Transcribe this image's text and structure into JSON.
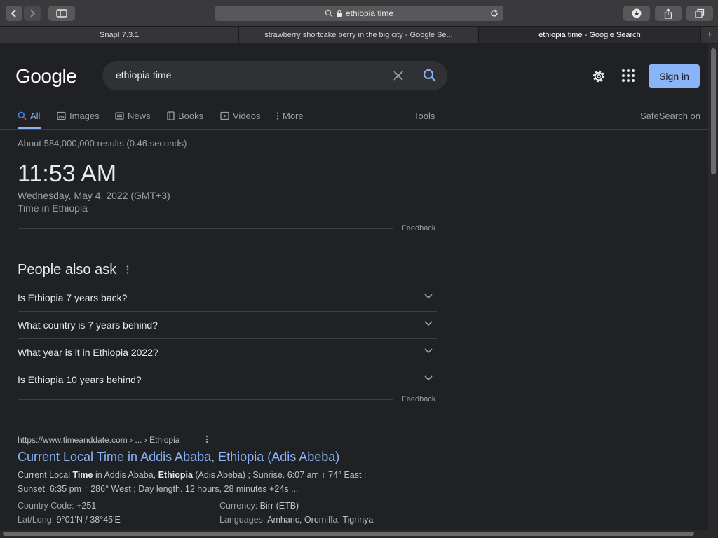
{
  "browser": {
    "address": "ethiopia time",
    "tabs": [
      {
        "label": "Snap! 7.3.1",
        "active": false
      },
      {
        "label": "strawberry shortcake berry in the big city - Google Se...",
        "active": false
      },
      {
        "label": "ethiopia time - Google Search",
        "active": true
      }
    ],
    "new_tab_symbol": "+"
  },
  "header": {
    "logo": "Google",
    "query": "ethiopia time",
    "signin_label": "Sign in"
  },
  "nav": {
    "items": [
      {
        "label": "All",
        "icon": "search-icon"
      },
      {
        "label": "Images",
        "icon": "image-icon"
      },
      {
        "label": "News",
        "icon": "news-icon"
      },
      {
        "label": "Books",
        "icon": "book-icon"
      },
      {
        "label": "Videos",
        "icon": "video-icon"
      },
      {
        "label": "More",
        "icon": "more-vertical-icon"
      }
    ],
    "tools": "Tools",
    "safesearch": "SafeSearch on"
  },
  "results": {
    "stats": "About 584,000,000 results (0.46 seconds)",
    "time_card": {
      "time": "11:53 AM",
      "date": "Wednesday, May 4, 2022 (GMT+3)",
      "place": "Time in Ethiopia",
      "feedback": "Feedback"
    },
    "people_also_ask": {
      "title": "People also ask",
      "questions": [
        "Is Ethiopia 7 years back?",
        "What country is 7 years behind?",
        "What year is it in Ethiopia 2022?",
        "Is Ethiopia 10 years behind?"
      ],
      "feedback": "Feedback"
    },
    "first_result": {
      "cite": "https://www.timeanddate.com › ... › Ethiopia",
      "title": "Current Local Time in Addis Ababa, Ethiopia (Adis Abeba)",
      "snippet_parts": {
        "p1": "Current Local ",
        "b1": "Time",
        "p2": " in Addis Ababa, ",
        "b2": "Ethiopia",
        "p3": " (Adis Abeba) ; Sunrise. 6:07 am ↑ 74° East ; Sunset. 6:35 pm ↑ 286° West ; Day length. 12 hours, 28 minutes +24s ..."
      },
      "facts": {
        "country_code_label": "Country Code:",
        "country_code": "+251",
        "latlong_label": "Lat/Long:",
        "latlong": "9°01'N / 38°45'E",
        "currency_label": "Currency:",
        "currency": "Birr (ETB)",
        "languages_label": "Languages:",
        "languages": "Amharic, Oromiffa, Tigrinya"
      }
    }
  },
  "colors": {
    "page_bg": "#202124",
    "link": "#8ab4f8",
    "text": "#e8eaed",
    "muted": "#9aa0a6"
  }
}
